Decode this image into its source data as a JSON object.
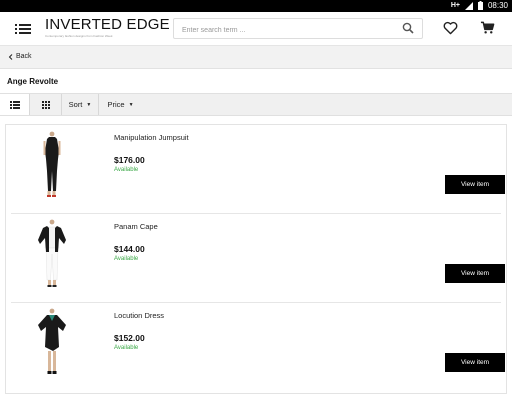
{
  "status_bar": {
    "network": "H+",
    "time": "08:30",
    "icons": [
      "signal-icon",
      "battery-icon"
    ]
  },
  "header": {
    "logo_name": "INVERTED EDGE",
    "logo_tagline": "Contemporary fashion designs from Fashion Week",
    "search_placeholder": "Enter search term ...",
    "icons": [
      "menu-icon",
      "search-icon",
      "heart-icon",
      "cart-icon"
    ]
  },
  "nav": {
    "back_label": "Back"
  },
  "page": {
    "title": "Ange Revolte"
  },
  "toolbar": {
    "view_options": [
      "list-view-icon",
      "grid-view-icon"
    ],
    "sort_label": "Sort",
    "price_label": "Price"
  },
  "products": [
    {
      "name": "Manipulation Jumpsuit",
      "price": "$176.00",
      "availability": "Available",
      "button_label": "View item"
    },
    {
      "name": "Panam Cape",
      "price": "$144.00",
      "availability": "Available",
      "button_label": "View item"
    },
    {
      "name": "Locution Dress",
      "price": "$152.00",
      "availability": "Available",
      "button_label": "View item"
    }
  ],
  "colors": {
    "accent": "#000000",
    "available": "#3aa846",
    "toolbar_bg": "#f0f0f0"
  }
}
